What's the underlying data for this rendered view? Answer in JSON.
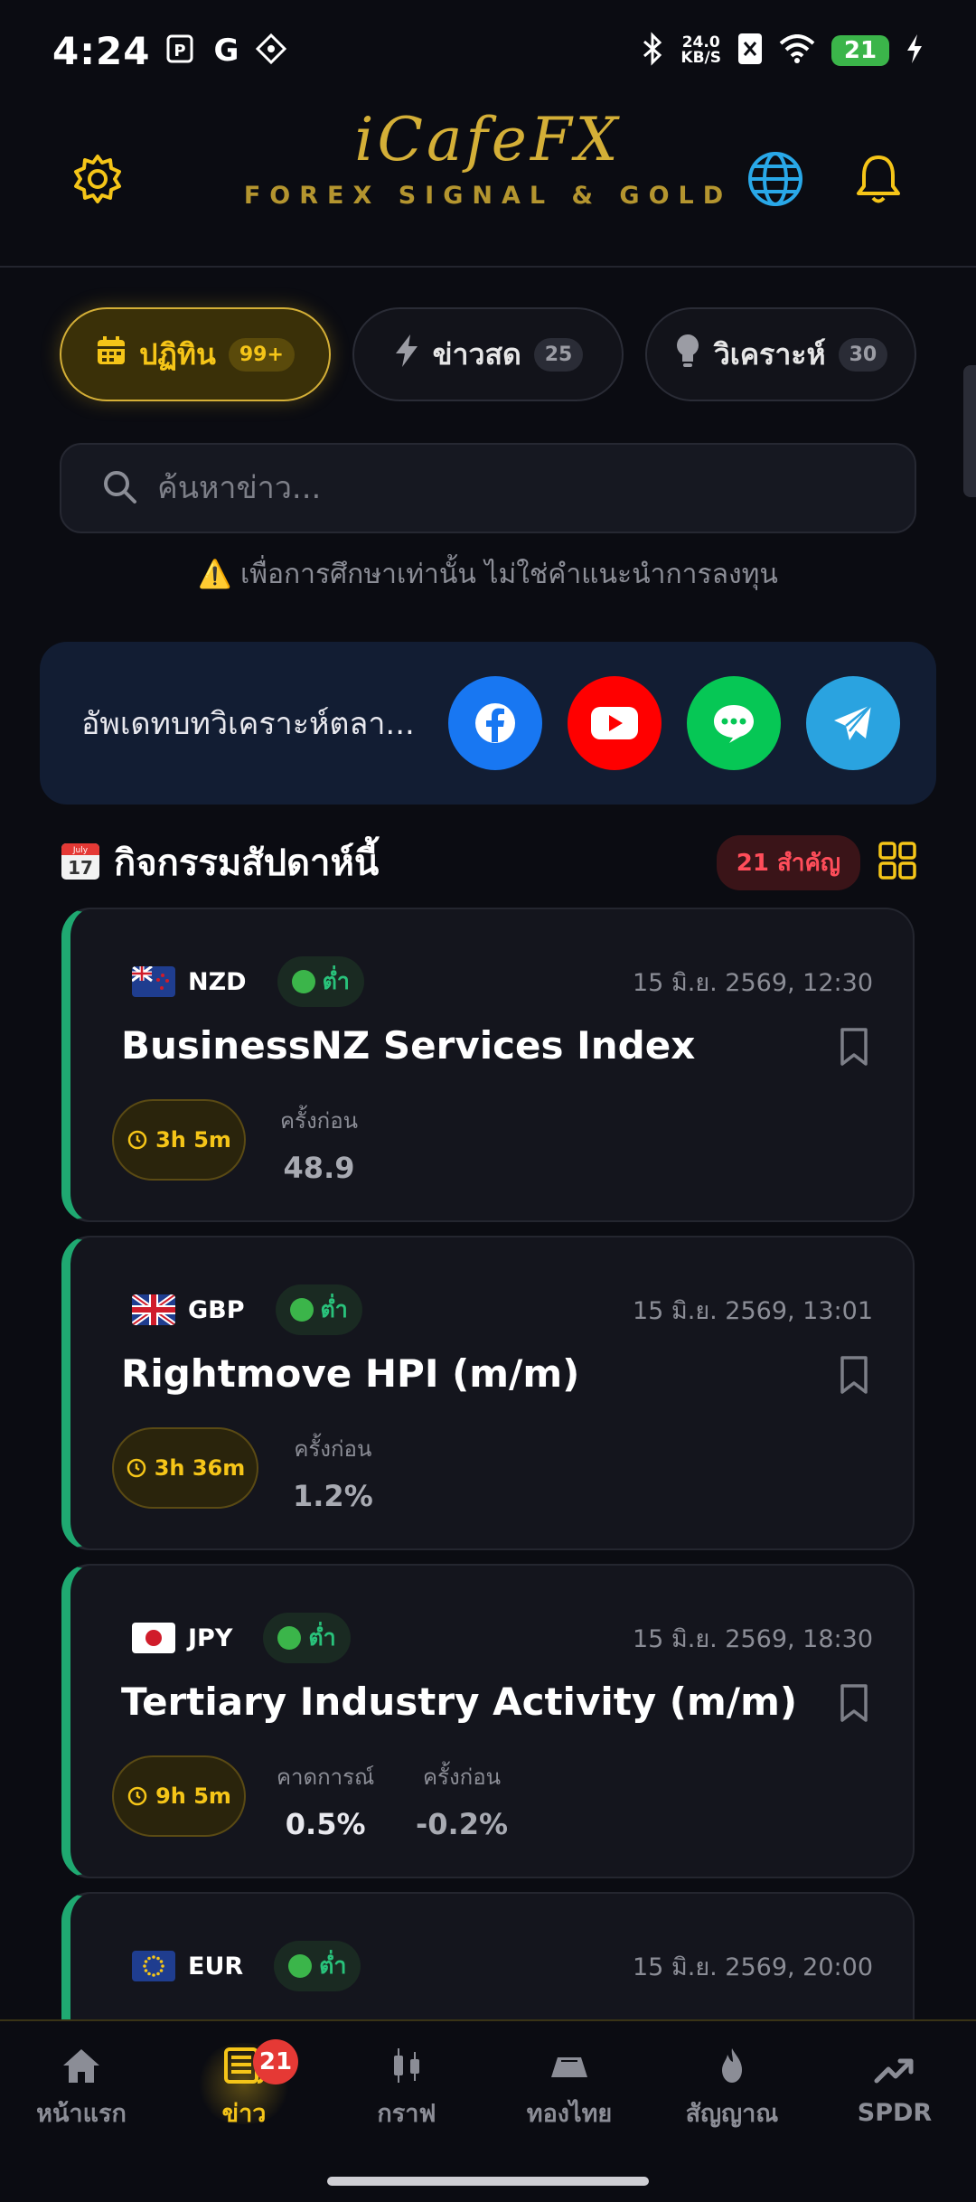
{
  "status_bar": {
    "time": "4:24",
    "speed_value": "24.0",
    "speed_unit": "KB/S",
    "battery": "21"
  },
  "header": {
    "logo": "iCafeFX",
    "subtitle": "FOREX SIGNAL & GOLD"
  },
  "tabs": [
    {
      "label": "ปฏิทิน",
      "count": "99+",
      "icon": "calendar-icon",
      "active": true
    },
    {
      "label": "ข่าวสด",
      "count": "25",
      "icon": "bolt-icon"
    },
    {
      "label": "วิเคราะห์",
      "count": "30",
      "icon": "bulb-icon"
    }
  ],
  "search": {
    "placeholder": "ค้นหาข่าว..."
  },
  "disclaimer": "⚠️ เพื่อการศึกษาเท่านั้น ไม่ใช่คำแนะนำการลงทุน",
  "social": {
    "text": "อัพเดทบทวิเคราะห์ตลา...",
    "colors": {
      "facebook": "#1877f2",
      "youtube": "#ff0000",
      "line": "#06c755",
      "telegram": "#2aa3e0"
    }
  },
  "section": {
    "calendar_label": "July",
    "calendar_day": "17",
    "title": "กิจกรรมสัปดาห์นี้",
    "badge": "21 สำคัญ"
  },
  "events": [
    {
      "currency": "NZD",
      "impact": "ต่ำ",
      "date": "15 มิ.ย. 2569, 12:30",
      "title": "BusinessNZ Services Index",
      "timer": "3h 5m",
      "previous_label": "ครั้งก่อน",
      "previous": "48.9"
    },
    {
      "currency": "GBP",
      "impact": "ต่ำ",
      "date": "15 มิ.ย. 2569, 13:01",
      "title": "Rightmove HPI (m/m)",
      "timer": "3h 36m",
      "previous_label": "ครั้งก่อน",
      "previous": "1.2%"
    },
    {
      "currency": "JPY",
      "impact": "ต่ำ",
      "date": "15 มิ.ย. 2569, 18:30",
      "title": "Tertiary Industry Activity (m/m)",
      "timer": "9h 5m",
      "forecast_label": "คาดการณ์",
      "forecast": "0.5%",
      "previous_label": "ครั้งก่อน",
      "previous": "-0.2%"
    },
    {
      "currency": "EUR",
      "impact": "ต่ำ",
      "date": "15 มิ.ย. 2569, 20:00"
    }
  ],
  "bottom_nav": [
    {
      "label": "หน้าแรก",
      "icon": "home-icon"
    },
    {
      "label": "ข่าว",
      "icon": "news-icon",
      "badge": "21",
      "active": true
    },
    {
      "label": "กราฟ",
      "icon": "candles-icon"
    },
    {
      "label": "ทองไทย",
      "icon": "gold-bar-icon"
    },
    {
      "label": "สัญญาณ",
      "icon": "flame-icon"
    },
    {
      "label": "SPDR",
      "icon": "trend-icon"
    }
  ],
  "accent_color": "#f5c518",
  "impact_color": "#1fa971"
}
